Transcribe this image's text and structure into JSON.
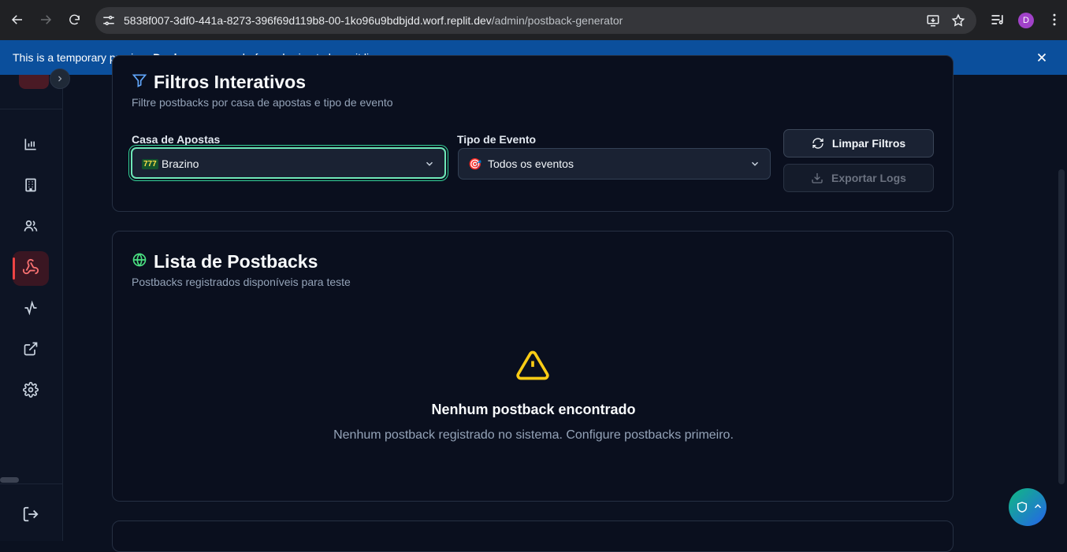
{
  "browser": {
    "url_host": "5838f007-3df0-441a-8273-396f69d119b8-00-1ko96u9bdbjdd.worf.replit.dev",
    "url_path": "/admin/postback-generator",
    "profile_initial": "D"
  },
  "banner": {
    "text_before": "This is a temporary preview. ",
    "link": "Deploy your app",
    "text_after": " before sharing to keep it live."
  },
  "sidebar": {
    "items": [
      {
        "icon": "bar-chart-icon",
        "active": false
      },
      {
        "icon": "building-icon",
        "active": false
      },
      {
        "icon": "users-icon",
        "active": false
      },
      {
        "icon": "webhook-icon",
        "active": true
      },
      {
        "icon": "activity-icon",
        "active": false
      },
      {
        "icon": "external-link-icon",
        "active": false
      },
      {
        "icon": "gear-icon",
        "active": false
      }
    ],
    "logout_icon": "logout-icon"
  },
  "filters": {
    "title": "Filtros Interativos",
    "subtitle": "Filtre postbacks por casa de apostas e tipo de evento",
    "casa_label": "Casa de Apostas",
    "casa_emoji": "777",
    "casa_value": "Brazino",
    "evento_label": "Tipo de Evento",
    "evento_emoji": "🎯",
    "evento_value": "Todos os eventos",
    "clear_button": "Limpar Filtros",
    "export_button": "Exportar Logs"
  },
  "postbacks": {
    "title": "Lista de Postbacks",
    "subtitle": "Postbacks registrados disponíveis para teste",
    "empty_title": "Nenhum postback encontrado",
    "empty_desc": "Nenhum postback registrado no sistema. Configure postbacks primeiro."
  },
  "colors": {
    "accent": "#ef4444",
    "focus_ring": "#34d399",
    "warning": "#facc15",
    "banner": "#0b4f9c"
  }
}
